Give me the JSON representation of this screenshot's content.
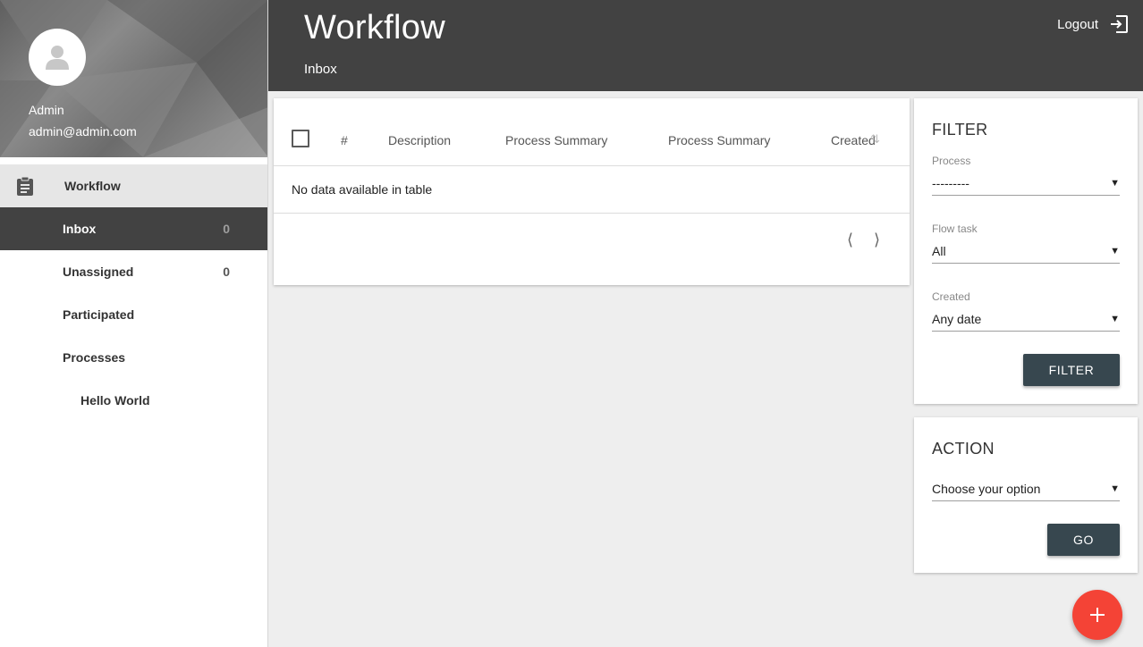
{
  "user": {
    "name": "Admin",
    "email": "admin@admin.com"
  },
  "nav": {
    "section": "Workflow",
    "items": [
      {
        "label": "Inbox",
        "count": "0"
      },
      {
        "label": "Unassigned",
        "count": "0"
      },
      {
        "label": "Participated"
      },
      {
        "label": "Processes"
      },
      {
        "label": "Hello World"
      }
    ]
  },
  "header": {
    "title": "Workflow",
    "subtitle": "Inbox",
    "logout": "Logout"
  },
  "table": {
    "columns": [
      "#",
      "Description",
      "Process Summary",
      "Process Summary",
      "Created"
    ],
    "empty_message": "No data available in table",
    "prev": "⟨",
    "next": "⟩"
  },
  "filter": {
    "title": "FILTER",
    "process_label": "Process",
    "process_value": "---------",
    "flow_task_label": "Flow task",
    "flow_task_value": "All",
    "created_label": "Created",
    "created_value": "Any date",
    "button": "FILTER"
  },
  "action": {
    "title": "ACTION",
    "select_value": "Choose your option",
    "button": "GO"
  },
  "fab": {
    "symbol": "+"
  },
  "colors": {
    "header_bg": "#424242",
    "button_bg": "#37474f",
    "fab_bg": "#f44336"
  }
}
